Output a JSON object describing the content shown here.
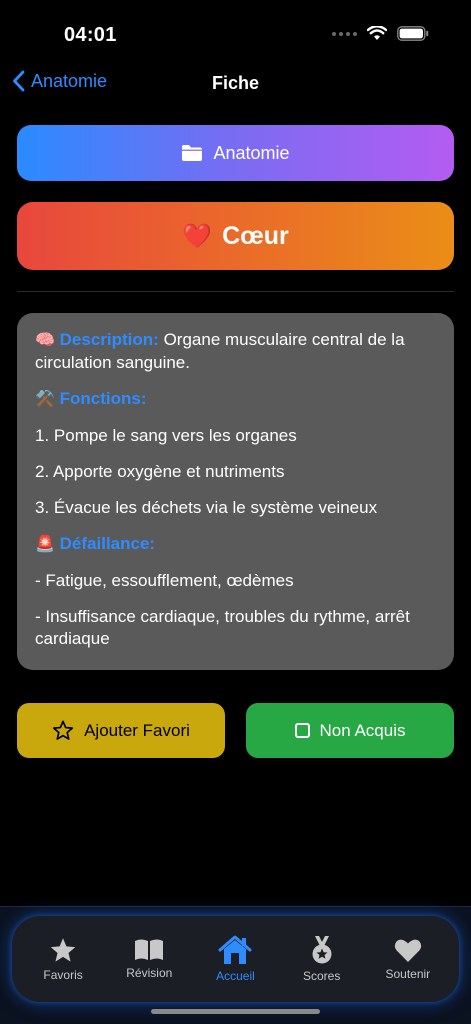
{
  "status": {
    "time": "04:01"
  },
  "nav": {
    "back_label": "Anatomie",
    "title": "Fiche"
  },
  "category": {
    "label": "Anatomie"
  },
  "card_title": {
    "emoji": "❤️",
    "label": "Cœur"
  },
  "card": {
    "description_emoji": "🧠",
    "description_heading": "Description:",
    "description_text": "Organe musculaire central de la circulation sanguine.",
    "fonctions_emoji": "⚒️",
    "fonctions_heading": "Fonctions:",
    "fonctions": [
      "1. Pompe le sang vers les organes",
      "2. Apporte oxygène et nutriments",
      "3. Évacue les déchets via le système veineux"
    ],
    "defaillance_emoji": "🚨",
    "defaillance_heading": "Défaillance:",
    "defaillance": [
      "- Fatigue, essoufflement, œdèmes",
      "- Insuffisance cardiaque, troubles du rythme, arrêt cardiaque"
    ]
  },
  "actions": {
    "favorite_label": "Ajouter Favori",
    "acquired_label": "Non Acquis"
  },
  "tabs": [
    {
      "label": "Favoris",
      "icon": "star-icon"
    },
    {
      "label": "Révision",
      "icon": "book-icon"
    },
    {
      "label": "Accueil",
      "icon": "house-icon",
      "active": true
    },
    {
      "label": "Scores",
      "icon": "medal-icon"
    },
    {
      "label": "Soutenir",
      "icon": "heart-icon"
    }
  ],
  "colors": {
    "accent": "#2f8cff",
    "favorite_button": "#c9a80e",
    "acquired_button": "#27a844",
    "card_background": "#5a5a5a"
  }
}
